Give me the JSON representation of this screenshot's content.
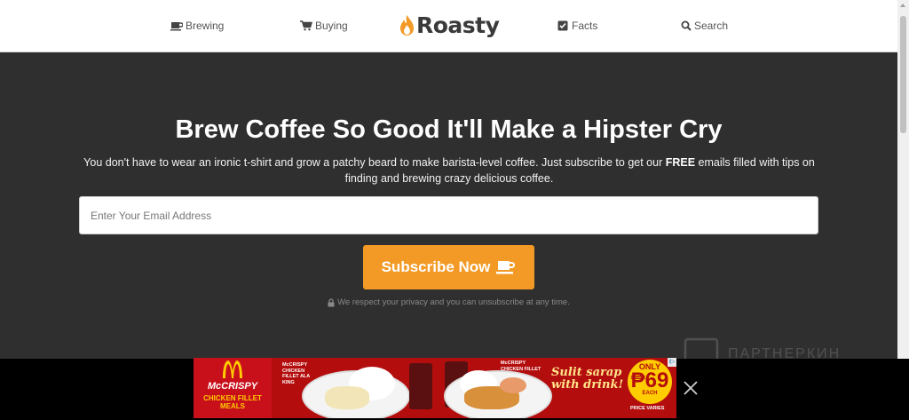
{
  "nav": {
    "brewing_label": "Brewing",
    "buying_label": "Buying",
    "logo_text": "Roasty",
    "facts_label": "Facts",
    "search_label": "Search"
  },
  "hero": {
    "headline": "Brew Coffee So Good It'll Make a Hipster Cry",
    "subtext_before": "You don't have to wear an ironic t-shirt and grow a patchy beard to make barista-level coffee. Just subscribe to get our ",
    "subtext_bold": "FREE",
    "subtext_after": " emails filled with tips on finding and brewing crazy delicious coffee.",
    "email_placeholder": "Enter Your Email Address",
    "subscribe_label": "Subscribe Now",
    "privacy_note": "We respect your privacy and you can unsubscribe at any time."
  },
  "partner": {
    "text": "ПАРТНЕРКИН"
  },
  "ad": {
    "mccrispy": "McCRISPY",
    "chicken_fillet_meals": "CHICKEN FILLET MEALS",
    "item1_label": "McCRISPY CHICKEN FILLET ALA KING",
    "item2_label": "McCRISPY CHICKEN FILLET",
    "slogan": "Sulit sarap with drink!",
    "only": "ONLY",
    "price": "₱69",
    "each": "EACH",
    "price_varies": "PRICE VARIES",
    "info_badge": "i▷"
  },
  "colors": {
    "accent_orange": "#f39a26",
    "hero_background": "#2f2f2f",
    "ad_red": "#b40d0d"
  }
}
